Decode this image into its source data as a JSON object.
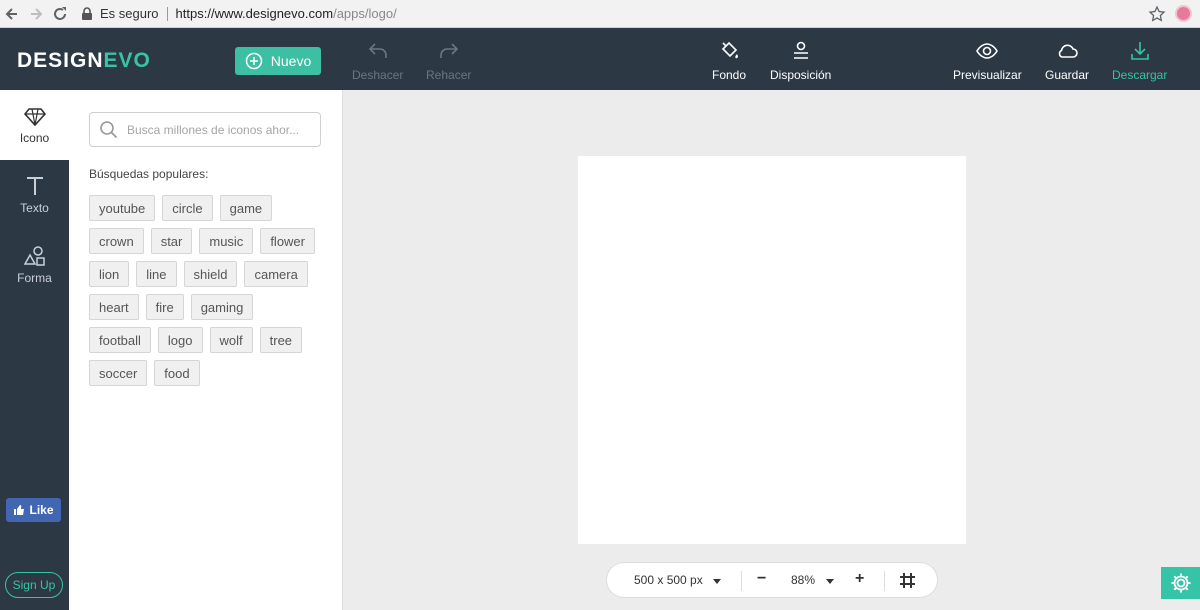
{
  "browser": {
    "secure_label": "Es seguro",
    "url_host": "https://www.designevo.com",
    "url_path": "/apps/logo/"
  },
  "header": {
    "logo_design": "DESIGN",
    "logo_evo": "EVO",
    "new_label": "Nuevo",
    "undo_label": "Deshacer",
    "redo_label": "Rehacer",
    "background_label": "Fondo",
    "layout_label": "Disposición",
    "preview_label": "Previsualizar",
    "save_label": "Guardar",
    "download_label": "Descargar"
  },
  "rail": {
    "icon_tab": "Icono",
    "text_tab": "Texto",
    "shape_tab": "Forma",
    "like_label": "Like",
    "signup_label": "Sign Up"
  },
  "panel": {
    "search_placeholder": "Busca millones de iconos ahor...",
    "popular_title": "Búsquedas populares:",
    "tags": [
      [
        "youtube",
        "circle",
        "game"
      ],
      [
        "crown",
        "star",
        "music",
        "flower"
      ],
      [
        "lion",
        "line",
        "shield",
        "camera"
      ],
      [
        "heart",
        "fire",
        "gaming"
      ],
      [
        "football",
        "logo",
        "wolf",
        "tree"
      ],
      [
        "soccer",
        "food"
      ]
    ]
  },
  "zoombar": {
    "size_label": "500 x 500 px",
    "zoom_label": "88%",
    "minus": "−",
    "plus": "+"
  },
  "colors": {
    "header_bg": "#2d3845",
    "accent": "#36c4a6",
    "facebook": "#4267b2"
  }
}
